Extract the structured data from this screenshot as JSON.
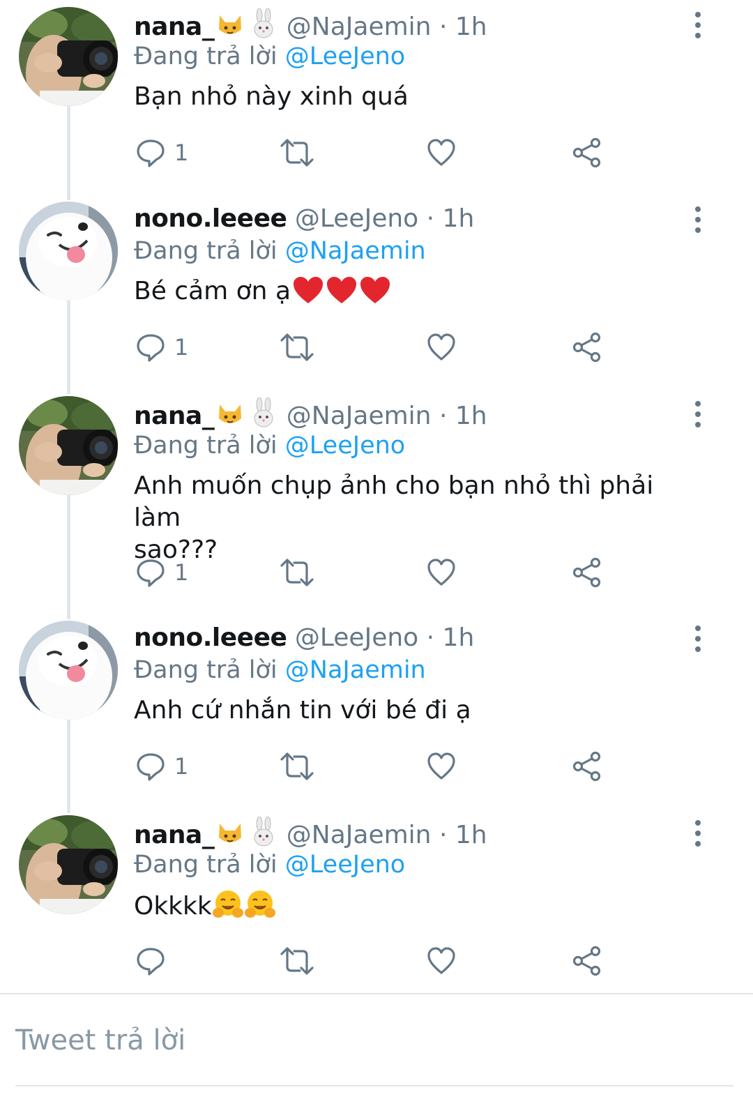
{
  "colors": {
    "link": "#1da1f2",
    "secondary_text": "#657786",
    "primary_text": "#14171a",
    "thread_line": "#e1e6ea",
    "icon": "#657786"
  },
  "icons": {
    "reply": "reply-icon",
    "retweet": "retweet-icon",
    "like": "heart-icon",
    "share": "share-icon",
    "more": "more-vertical-icon"
  },
  "tweets": [
    {
      "display_name": "nana_",
      "name_emojis": [
        "cat-face-emoji",
        "rabbit-emoji"
      ],
      "handle": "@NaJaemin",
      "separator": "·",
      "time": "1h",
      "reply_prefix": "Đang trả lời",
      "reply_to": "@LeeJeno",
      "text": "Bạn nhỏ này xinh quá",
      "reply_count": "1",
      "avatar": "photographer"
    },
    {
      "display_name": "nono.leeee",
      "name_emojis": [],
      "handle": "@LeeJeno",
      "separator": "·",
      "time": "1h",
      "reply_prefix": "Đang trả lời",
      "reply_to": "@NaJaemin",
      "text": "Bé cảm ơn ạ",
      "text_emojis": [
        "red-heart-emoji",
        "red-heart-emoji",
        "red-heart-emoji"
      ],
      "reply_count": "1",
      "avatar": "samoyed-dog"
    },
    {
      "display_name": "nana_",
      "name_emojis": [
        "cat-face-emoji",
        "rabbit-emoji"
      ],
      "handle": "@NaJaemin",
      "separator": "·",
      "time": "1h",
      "reply_prefix": "Đang trả lời",
      "reply_to": "@LeeJeno",
      "text": "Anh muốn chụp ảnh cho bạn nhỏ thì phải làm\nsao???",
      "reply_count": "1",
      "avatar": "photographer"
    },
    {
      "display_name": "nono.leeee",
      "name_emojis": [],
      "handle": "@LeeJeno",
      "separator": "·",
      "time": "1h",
      "reply_prefix": "Đang trả lời",
      "reply_to": "@NaJaemin",
      "text": "Anh cứ nhắn tin với bé đi ạ",
      "reply_count": "1",
      "avatar": "samoyed-dog"
    },
    {
      "display_name": "nana_",
      "name_emojis": [
        "cat-face-emoji",
        "rabbit-emoji"
      ],
      "handle": "@NaJaemin",
      "separator": "·",
      "time": "1h",
      "reply_prefix": "Đang trả lời",
      "reply_to": "@LeeJeno",
      "text": "Okkkk",
      "text_emojis": [
        "hugging-face-emoji",
        "hugging-face-emoji"
      ],
      "reply_count": "",
      "avatar": "photographer"
    }
  ],
  "compose": {
    "placeholder": "Tweet trả lời"
  }
}
